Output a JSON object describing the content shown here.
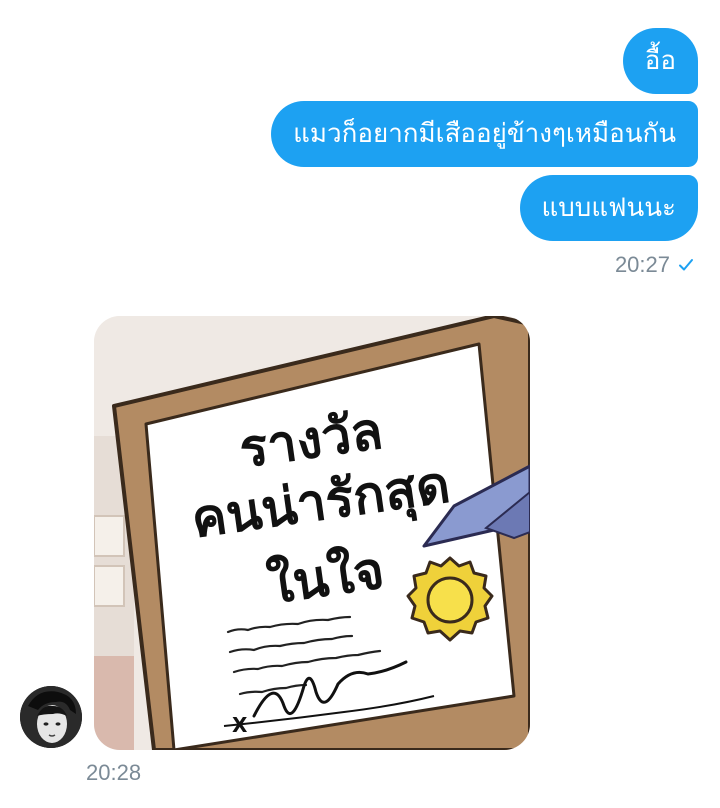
{
  "messages": {
    "sent": [
      {
        "text": "อื้อ"
      },
      {
        "text": "แมวก็อยากมีเสืออยู่ข้างๆเหมือนกัน"
      },
      {
        "text": "แบบแฟนนะ"
      }
    ],
    "sent_time": "20:27",
    "sent_status_icon": "check-icon",
    "received_image": {
      "lines": [
        "รางวัล",
        "คนน่ารักสุด",
        "ในใจ"
      ],
      "corner_mark": "X"
    },
    "received_time": "20:28"
  },
  "colors": {
    "bubble": "#1da1f2",
    "timestamp": "#7b8a96",
    "check": "#1da1f2"
  }
}
